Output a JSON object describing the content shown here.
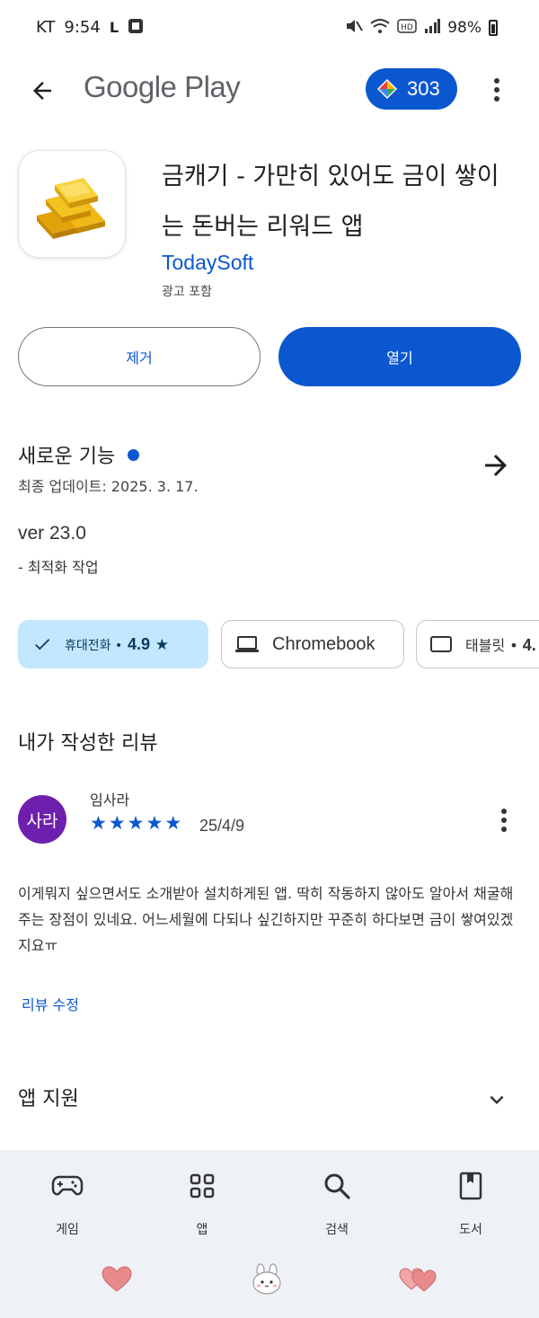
{
  "status_bar": {
    "carrier": "KT",
    "time": "9:54",
    "battery": "98%"
  },
  "top_bar": {
    "brand": "Google Play",
    "points": "303"
  },
  "app": {
    "title": "금캐기 - 가만히 있어도 금이 쌓이는 돈버는 리워드 앱",
    "developer": "TodaySoft",
    "ads_note": "광고 포함",
    "uninstall_label": "제거",
    "open_label": "열기"
  },
  "whats_new": {
    "title": "새로운 기능",
    "updated": "최종 업데이트: 2025. 3. 17.",
    "version": "ver 23.0",
    "note": "- 최적화 작업"
  },
  "devices": [
    {
      "label": "휴대전화 •",
      "rating": "4.9",
      "selected": true
    },
    {
      "label": "Chromebook",
      "selected": false
    },
    {
      "label": "태블릿 •",
      "rating": "4.",
      "selected": false
    }
  ],
  "my_review": {
    "title": "내가 작성한 리뷰",
    "avatar_text": "사라",
    "reviewer": "임사라",
    "stars": 5,
    "date": "25/4/9",
    "text": "이게뭐지 싶으면서도 소개받아 설치하게된 앱. 딱히 작동하지 않아도 알아서 채굴해주는 장점이 있네요. 어느세월에 다되나 싶긴하지만 꾸준히 하다보면 금이 쌓여있겠지요ㅠ",
    "edit_label": "리뷰 수정"
  },
  "app_support": {
    "title": "앱 지원"
  },
  "bottom_nav": {
    "games": "게임",
    "apps": "앱",
    "search": "검색",
    "books": "도서"
  },
  "colors": {
    "accent": "#0b57d0",
    "chip_selected": "#c2e7ff",
    "avatar": "#6f1fae",
    "nav_bg": "#eef2f7",
    "heart": "#e8898c"
  }
}
